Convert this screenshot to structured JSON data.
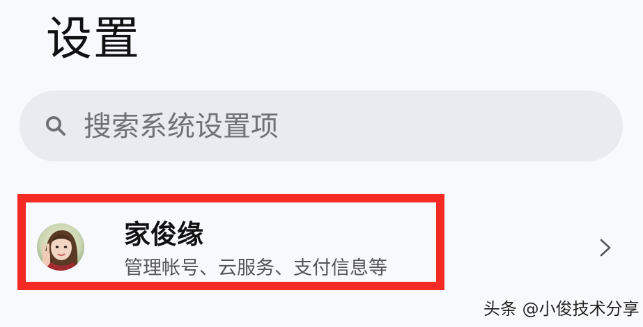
{
  "header": {
    "title": "设置"
  },
  "search": {
    "placeholder": "搜索系统设置项",
    "icon": "search-icon"
  },
  "account": {
    "name": "家俊缘",
    "description": "管理帐号、云服务、支付信息等",
    "chevron_icon": "chevron-right-icon"
  },
  "highlight": {
    "color": "#f42a25"
  },
  "watermark": {
    "text": "头条 @小俊技术分享"
  }
}
